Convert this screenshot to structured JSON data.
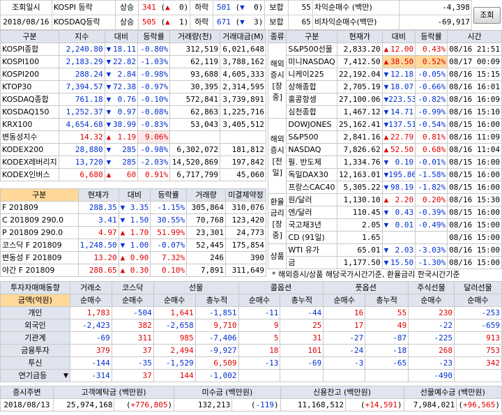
{
  "top": {
    "label_time": "조회일시",
    "date": "2018/08/16",
    "rows": [
      {
        "mkt": "KOSPI 등락",
        "up_l": "상승",
        "up": "341",
        "up_ar": "▲",
        "up_lim": "0",
        "dn_l": "하락",
        "dn": "501",
        "dn_ar": "▼",
        "dn_lim": "0",
        "flat_l": "보합",
        "flat": "55",
        "bal_l": "차익순매수 (백만)",
        "bal": "-4,398"
      },
      {
        "mkt": "KOSDAQ등락",
        "up_l": "상승",
        "up": "505",
        "up_ar": "▲",
        "up_lim": "1",
        "dn_l": "하락",
        "dn": "671",
        "dn_ar": "▼",
        "dn_lim": "3",
        "flat_l": "보합",
        "flat": "65",
        "bal_l": "비차익순매수(백만)",
        "bal": "-69,917"
      }
    ],
    "query_button": "조회"
  },
  "kor": {
    "headers": [
      "구분",
      "지수",
      "대비",
      "등락률",
      "거래량(천)",
      "거래대금(M)"
    ],
    "rows": [
      {
        "n": "KOSPI종합",
        "v": "2,240.80",
        "d": "dn",
        "c": "18.11",
        "p": "-0.80%",
        "vol": "312,519",
        "amt": "6,021,648"
      },
      {
        "n": "KOSPI100",
        "v": "2,183.29",
        "d": "dn",
        "c": "22.82",
        "p": "-1.03%",
        "vol": "62,119",
        "amt": "3,788,162"
      },
      {
        "n": "KOSPI200",
        "v": "288.24",
        "d": "dn",
        "c": "2.84",
        "p": "-0.98%",
        "vol": "93,688",
        "amt": "4,605,333"
      },
      {
        "n": "KTOP30",
        "v": "7,394.57",
        "d": "dn",
        "c": "72.38",
        "p": "-0.97%",
        "vol": "30,395",
        "amt": "2,314,595"
      },
      {
        "n": "KOSDAQ종합",
        "v": "761.18",
        "d": "dn",
        "c": "0.76",
        "p": "-0.10%",
        "vol": "572,841",
        "amt": "3,739,891"
      },
      {
        "n": "KOSDAQ150",
        "v": "1,252.37",
        "d": "dn",
        "c": "0.97",
        "p": "-0.08%",
        "vol": "62,863",
        "amt": "1,225,716"
      },
      {
        "n": "KRX100",
        "v": "4,654.68",
        "d": "dn",
        "c": "38.99",
        "p": "-0.83%",
        "vol": "53,043",
        "amt": "3,405,512"
      },
      {
        "n": "변동성지수",
        "v": "14.32",
        "d": "up",
        "c": "1.19",
        "p": "9.06%",
        "vol": "",
        "amt": ""
      },
      {
        "n": "KODEX200",
        "v": "28,880",
        "d": "dn",
        "c": "285",
        "p": "-0.98%",
        "vol": "6,302,072",
        "amt": "181,812"
      },
      {
        "n": "KODEX레버리지",
        "v": "13,720",
        "d": "dn",
        "c": "285",
        "p": "-2.03%",
        "vol": "14,520,869",
        "amt": "197,842"
      },
      {
        "n": "KODEX인버스",
        "v": "6,680",
        "d": "up",
        "c": "60",
        "p": "0.91%",
        "vol": "6,717,799",
        "amt": "45,060"
      }
    ]
  },
  "fut": {
    "headers": [
      "구분",
      "현재가",
      "대비",
      "등락률",
      "거래량",
      "미결제약정"
    ],
    "rows": [
      {
        "n": "F 201809",
        "v": "288.35",
        "d": "dn",
        "c": "3.35",
        "p": "-1.15%",
        "vol": "305,864",
        "oi": "310,076"
      },
      {
        "n": "C 201809 290.0",
        "v": "3.41",
        "d": "dn",
        "c": "1.50",
        "p": "30.55%",
        "vol": "70,768",
        "oi": "123,420"
      },
      {
        "n": "P 201809 290.0",
        "v": "4.97",
        "d": "up",
        "c": "1.70",
        "p": "51.99%",
        "vol": "23,301",
        "oi": "24,773"
      },
      {
        "n": "코스닥 F 201809",
        "v": "1,248.50",
        "d": "dn",
        "c": "1.00",
        "p": "-0.07%",
        "vol": "52,445",
        "oi": "175,854"
      },
      {
        "n": "변동성 F 201809",
        "v": "13.20",
        "d": "up",
        "c": "0.90",
        "p": "7.32%",
        "vol": "246",
        "oi": "390"
      },
      {
        "n": "야간 F 201809",
        "v": "288.65",
        "d": "up",
        "c": "0.30",
        "p": "0.10%",
        "vol": "7,891",
        "oi": "311,649"
      }
    ]
  },
  "ovs": {
    "headers": [
      "종류",
      "구분",
      "현재가",
      "대비",
      "등락률",
      "시간"
    ],
    "groups": [
      {
        "label": "해외증시[장중]",
        "rows": [
          {
            "n": "S&P500선물",
            "v": "2,833.20",
            "d": "up",
            "c": "12.00",
            "p": "0.43%",
            "t": "08/16 21:51"
          },
          {
            "n": "미니NASDAQ",
            "v": "7,412.50",
            "d": "up",
            "c": "38.50",
            "p": "0.52%",
            "t": "08/17 00:09",
            "hl": "yel"
          },
          {
            "n": "니케이225",
            "v": "22,192.04",
            "d": "dn",
            "c": "12.18",
            "p": "-0.05%",
            "t": "08/16 15:15"
          },
          {
            "n": "상해종합",
            "v": "2,705.19",
            "d": "dn",
            "c": "18.07",
            "p": "-0.66%",
            "t": "08/16 16:01"
          },
          {
            "n": "홍콩항셍",
            "v": "27,100.06",
            "d": "dn",
            "c": "223.53",
            "p": "-0.82%",
            "t": "08/16 16:09"
          },
          {
            "n": "심천종합",
            "v": "1,467.12",
            "d": "dn",
            "c": "14.71",
            "p": "-0.99%",
            "t": "08/16 15:10"
          }
        ]
      },
      {
        "label": "해외증시[전일]",
        "rows": [
          {
            "n": "DOWJONES",
            "v": "25,162.41",
            "d": "dn",
            "c": "137.51",
            "p": "-0.54%",
            "t": "08/15 16:00"
          },
          {
            "n": "S&P500",
            "v": "2,841.16",
            "d": "up",
            "c": "22.79",
            "p": "0.81%",
            "t": "08/16 11:09"
          },
          {
            "n": "NASDAQ",
            "v": "7,826.62",
            "d": "up",
            "c": "52.50",
            "p": "0.68%",
            "t": "08/16 11:04"
          },
          {
            "n": "필. 반도체",
            "v": "1,334.76",
            "d": "dn",
            "c": "0.10",
            "p": "-0.01%",
            "t": "08/15 16:00"
          },
          {
            "n": "독일DAX30",
            "v": "12,163.01",
            "d": "dn",
            "c": "195.86",
            "p": "-1.58%",
            "t": "08/15 16:00"
          },
          {
            "n": "프랑스CAC40",
            "v": "5,305.22",
            "d": "dn",
            "c": "98.19",
            "p": "-1.82%",
            "t": "08/15 16:00"
          }
        ]
      },
      {
        "label": "환율금리[장중]",
        "rows": [
          {
            "n": "원/달러",
            "v": "1,130.10",
            "d": "up",
            "c": "2.20",
            "p": "0.20%",
            "t": "08/16 15:30"
          },
          {
            "n": "엔/달러",
            "v": "110.45",
            "d": "dn",
            "c": "0.43",
            "p": "-0.39%",
            "t": "08/15 16:00"
          },
          {
            "n": "국고채3년",
            "v": "2.05",
            "d": "dn",
            "c": "0.01",
            "p": "-0.49%",
            "t": "08/16 15:00"
          },
          {
            "n": "CD (91일)",
            "v": "1.65",
            "d": "",
            "c": "",
            "p": "",
            "t": "08/16 15:00"
          }
        ]
      },
      {
        "label": "상품",
        "rows": [
          {
            "n": "WTI 유가",
            "v": "65.01",
            "d": "dn",
            "c": "2.03",
            "p": "-3.03%",
            "t": "08/16 15:00"
          },
          {
            "n": "금",
            "v": "1,177.50",
            "d": "dn",
            "c": "15.50",
            "p": "-1.30%",
            "t": "08/16 15:00"
          }
        ]
      }
    ]
  },
  "note": "* 해외증시/상품 해당국가시간기준, 환율금리 한국시간기준",
  "inv": {
    "title": "투자자매매동향",
    "groups": [
      "거래소",
      "코스닥",
      "선물",
      "콜옵션",
      "풋옵션",
      "주식선물",
      "달러선물"
    ],
    "sub": [
      "순매수",
      "순매수",
      "순매수",
      "총누적",
      "순매수",
      "총누적",
      "순매수",
      "총누적",
      "순매수",
      "순매수"
    ],
    "unit_label": "금액(억원)",
    "rows": [
      {
        "n": "개인",
        "v": [
          "1,783",
          "-504",
          "1,641",
          "-1,851",
          "-11",
          "-44",
          "16",
          "55",
          "230",
          "-253"
        ]
      },
      {
        "n": "외국인",
        "v": [
          "-2,423",
          "382",
          "-2,658",
          "9,710",
          "9",
          "25",
          "17",
          "49",
          "-22",
          "-659"
        ]
      },
      {
        "n": "기관계",
        "v": [
          "-69",
          "311",
          "985",
          "-7,406",
          "5",
          "31",
          "-27",
          "-87",
          "-225",
          "913"
        ]
      },
      {
        "n": "금융투자",
        "v": [
          "379",
          "37",
          "2,494",
          "-9,927",
          "18",
          "101",
          "-24",
          "-18",
          "268",
          "753"
        ]
      },
      {
        "n": "투신",
        "v": [
          "-144",
          "-35",
          "-1,529",
          "6,509",
          "-13",
          "-69",
          "-3",
          "-65",
          "-23",
          "342"
        ]
      },
      {
        "n": "연기금등",
        "v": [
          "-314",
          "37",
          "144",
          "-1,002",
          "",
          "",
          "",
          "",
          "-490",
          ""
        ]
      }
    ]
  },
  "bot": {
    "headers": [
      "증시주변",
      "고객예탁금 (백만원)",
      "미수금 (백만원)",
      "신용잔고 (백만원)",
      "선물예수금 (백만원)"
    ],
    "date": "2018/08/13",
    "vals": [
      {
        "v": "25,974,168",
        "c": "+776,805",
        "d": "up"
      },
      {
        "v": "132,213",
        "c": "-119",
        "d": "dn"
      },
      {
        "v": "11,168,512",
        "c": "+14,591",
        "d": "up"
      },
      {
        "v": "7,984,021",
        "c": "+96,565",
        "d": "up"
      }
    ]
  },
  "colors": {
    "up": "#e00000",
    "down": "#0030d0",
    "header": "#dfe4ee",
    "highlight": "#ffd89a"
  }
}
